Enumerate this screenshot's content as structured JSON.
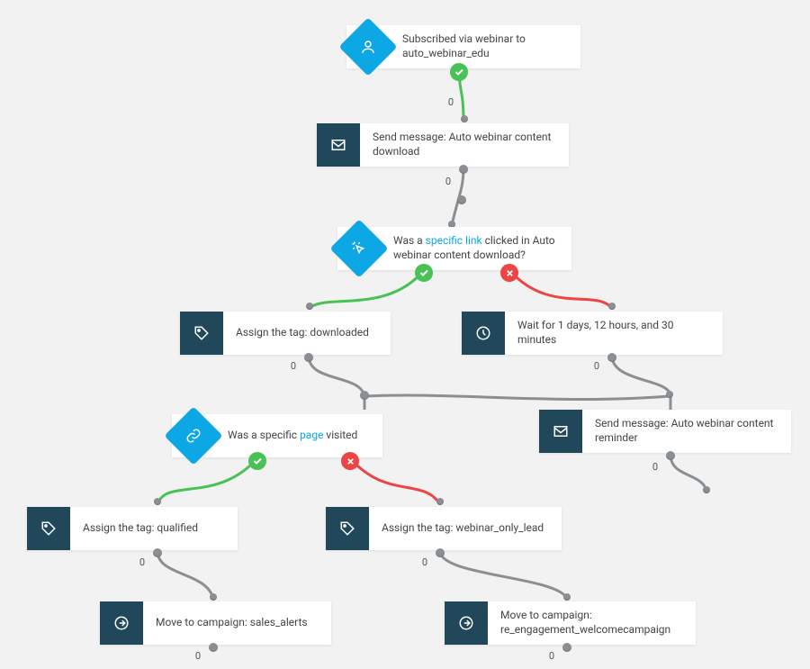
{
  "colors": {
    "accent": "#0ea7e6",
    "dark": "#20475a",
    "yes": "#48c155",
    "no": "#e44",
    "line": "#8a8f94"
  },
  "zero": "0",
  "nodes": {
    "start": {
      "text_pre": "Subscribed via webinar to ",
      "text_strong": "auto_webinar_edu",
      "icon": "person-icon"
    },
    "sendDl": {
      "text": "Send message: Auto webinar content download",
      "icon": "envelope-icon"
    },
    "qLink": {
      "text_pre": "Was a ",
      "link": "specific link",
      "text_post": " clicked in Auto webinar content download?",
      "icon": "cursor-click-icon"
    },
    "tagDl": {
      "text": "Assign the tag: downloaded",
      "icon": "tag-icon"
    },
    "wait": {
      "text": "Wait for 1 days, 12 hours, and 30 minutes",
      "icon": "clock-icon"
    },
    "qPage": {
      "text_pre": "Was a specific ",
      "link": "page",
      "text_post": " visited",
      "icon": "link-icon"
    },
    "sendRem": {
      "text": "Send message: Auto webinar content reminder",
      "icon": "envelope-icon"
    },
    "tagQual": {
      "text": "Assign the tag: qualified",
      "icon": "tag-icon"
    },
    "tagWol": {
      "text": "Assign the tag: webinar_only_lead",
      "icon": "tag-icon"
    },
    "mvSales": {
      "text": "Move to campaign: sales_alerts",
      "icon": "arrow-circle-icon"
    },
    "mvReeng": {
      "text_pre": "Move to campaign: ",
      "text_strong": "re_engagement_welcomecampaign",
      "icon": "arrow-circle-icon"
    }
  }
}
